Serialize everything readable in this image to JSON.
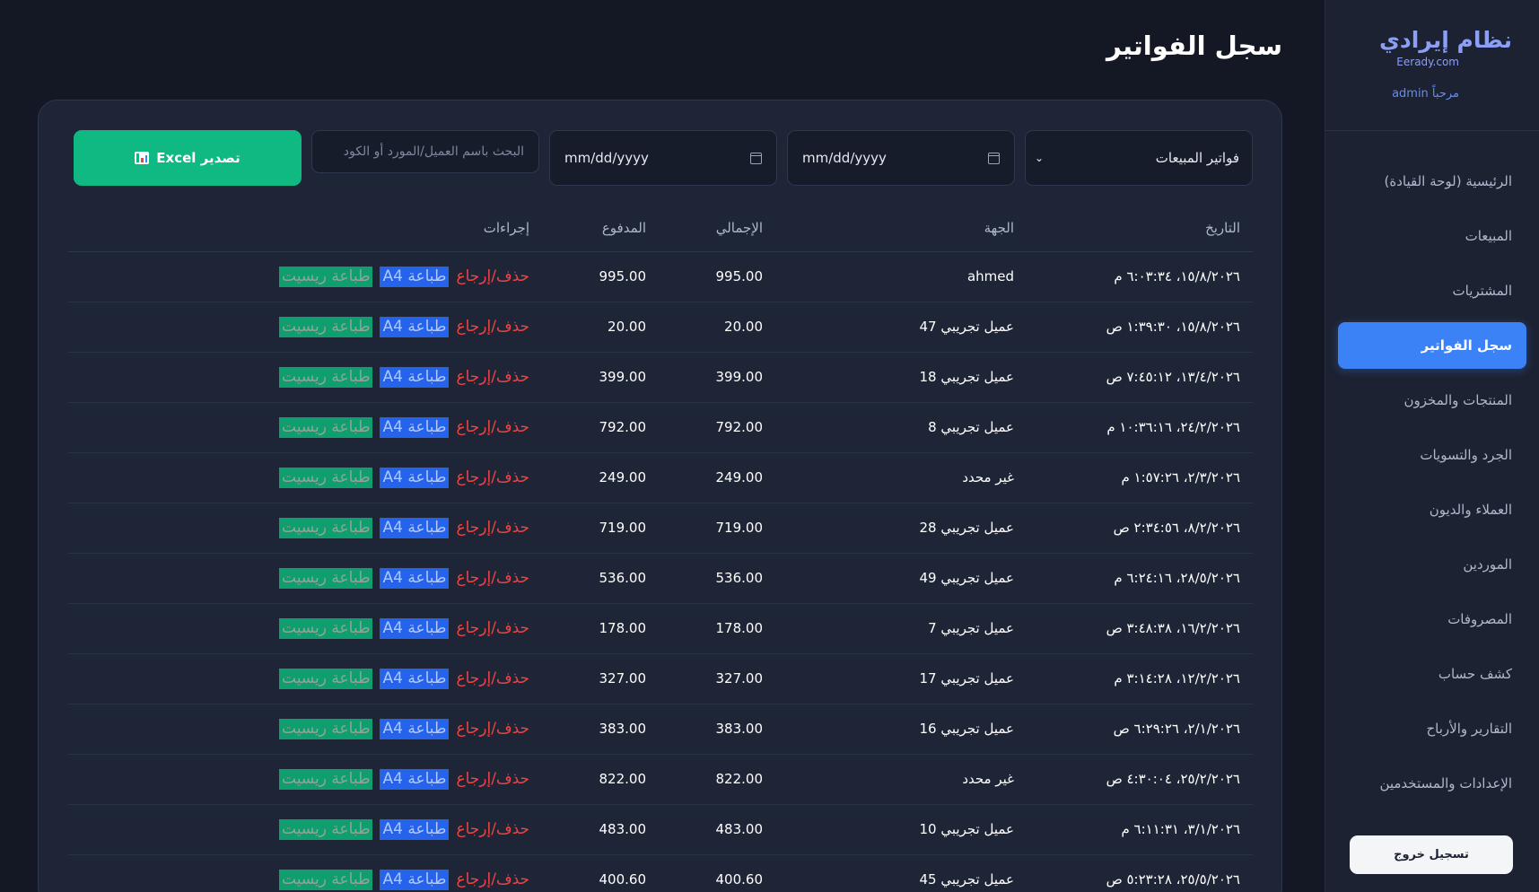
{
  "brand": {
    "title": "نظام إيرادي",
    "subtitle": "Eerady.com",
    "welcome": "مرحباً admin"
  },
  "sidebar": {
    "items": [
      {
        "label": "الرئيسية (لوحة القيادة)",
        "active": false
      },
      {
        "label": "المبيعات",
        "active": false
      },
      {
        "label": "المشتريات",
        "active": false
      },
      {
        "label": "سجل الفواتير",
        "active": true
      },
      {
        "label": "المنتجات والمخزون",
        "active": false
      },
      {
        "label": "الجرد والتسويات",
        "active": false
      },
      {
        "label": "العملاء والديون",
        "active": false
      },
      {
        "label": "الموردين",
        "active": false
      },
      {
        "label": "المصروفات",
        "active": false
      },
      {
        "label": "كشف حساب",
        "active": false
      },
      {
        "label": "التقارير والأرباح",
        "active": false
      },
      {
        "label": "الإعدادات والمستخدمين",
        "active": false
      }
    ],
    "logout_label": "تسجيل خروج"
  },
  "page": {
    "title": "سجل الفواتير"
  },
  "toolbar": {
    "invoice_type": "فواتير المبيعات",
    "date_from_placeholder": "mm/dd/yyyy",
    "date_to_placeholder": "mm/dd/yyyy",
    "search_placeholder": "البحث باسم العميل/المورد أو الكود",
    "export_label": "تصدير Excel"
  },
  "table": {
    "headers": {
      "date": "التاريخ",
      "party": "الجهة",
      "total": "الإجمالي",
      "paid": "المدفوع",
      "actions": "إجراءات"
    },
    "action_labels": {
      "delete": "حذف/إرجاع",
      "print_a4": "طباعة A4",
      "print_receipt": "طباعة ريسيت"
    },
    "rows": [
      {
        "date": "١٥/٨/٢٠٢٦، ٦:٠٣:٣٤ م",
        "party": "ahmed",
        "total": "995.00",
        "paid": "995.00"
      },
      {
        "date": "١٥/٨/٢٠٢٦، ١:٣٩:٣٠ ص",
        "party": "عميل تجريبي 47",
        "total": "20.00",
        "paid": "20.00"
      },
      {
        "date": "١٣/٤/٢٠٢٦، ٧:٤٥:١٢ ص",
        "party": "عميل تجريبي 18",
        "total": "399.00",
        "paid": "399.00"
      },
      {
        "date": "٢٤/٢/٢٠٢٦، ١٠:٣٦:١٦ م",
        "party": "عميل تجريبي 8",
        "total": "792.00",
        "paid": "792.00"
      },
      {
        "date": "٢/٣/٢٠٢٦، ١:٥٧:٢٦ م",
        "party": "غير محدد",
        "total": "249.00",
        "paid": "249.00"
      },
      {
        "date": "٨/٢/٢٠٢٦، ٢:٣٤:٥٦ ص",
        "party": "عميل تجريبي 28",
        "total": "719.00",
        "paid": "719.00"
      },
      {
        "date": "٢٨/٥/٢٠٢٦، ٦:٢٤:١٦ م",
        "party": "عميل تجريبي 49",
        "total": "536.00",
        "paid": "536.00"
      },
      {
        "date": "١٦/٢/٢٠٢٦، ٣:٤٨:٣٨ ص",
        "party": "عميل تجريبي 7",
        "total": "178.00",
        "paid": "178.00"
      },
      {
        "date": "١٢/٢/٢٠٢٦، ٣:١٤:٢٨ م",
        "party": "عميل تجريبي 17",
        "total": "327.00",
        "paid": "327.00"
      },
      {
        "date": "٢/١/٢٠٢٦، ٦:٢٩:٢٦ ص",
        "party": "عميل تجريبي 16",
        "total": "383.00",
        "paid": "383.00"
      },
      {
        "date": "٢٥/٢/٢٠٢٦، ٤:٣٠:٠٤ ص",
        "party": "غير محدد",
        "total": "822.00",
        "paid": "822.00"
      },
      {
        "date": "٣/١/٢٠٢٦، ٦:١١:٣١ م",
        "party": "عميل تجريبي 10",
        "total": "483.00",
        "paid": "483.00"
      },
      {
        "date": "٢٥/٥/٢٠٢٦، ٥:٢٣:٢٨ ص",
        "party": "عميل تجريبي 45",
        "total": "400.60",
        "paid": "400.60"
      }
    ]
  },
  "colors": {
    "accent": "#3b82f6",
    "success": "#10b981",
    "danger": "#ef4444"
  }
}
